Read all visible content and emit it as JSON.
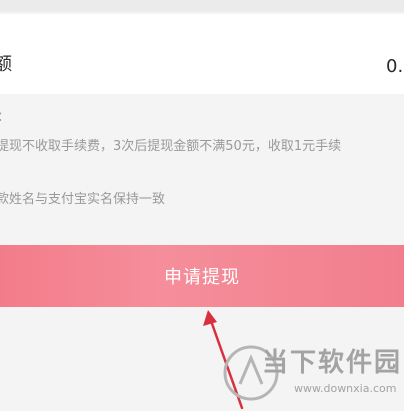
{
  "withdraw": {
    "amount_label": "额",
    "amount_value": "0."
  },
  "notes": {
    "heading": "：",
    "items": [
      "提现不收取手续费，3次后提现金额不满50元，收取1元手续",
      "款姓名与支付宝实名保持一致"
    ]
  },
  "actions": {
    "submit_label": "申请提现"
  },
  "watermark": {
    "site_name": "当下软件园",
    "url": "www.downxia.com"
  },
  "colors": {
    "accent": "#f58e9a",
    "arrow": "#d9303f"
  }
}
